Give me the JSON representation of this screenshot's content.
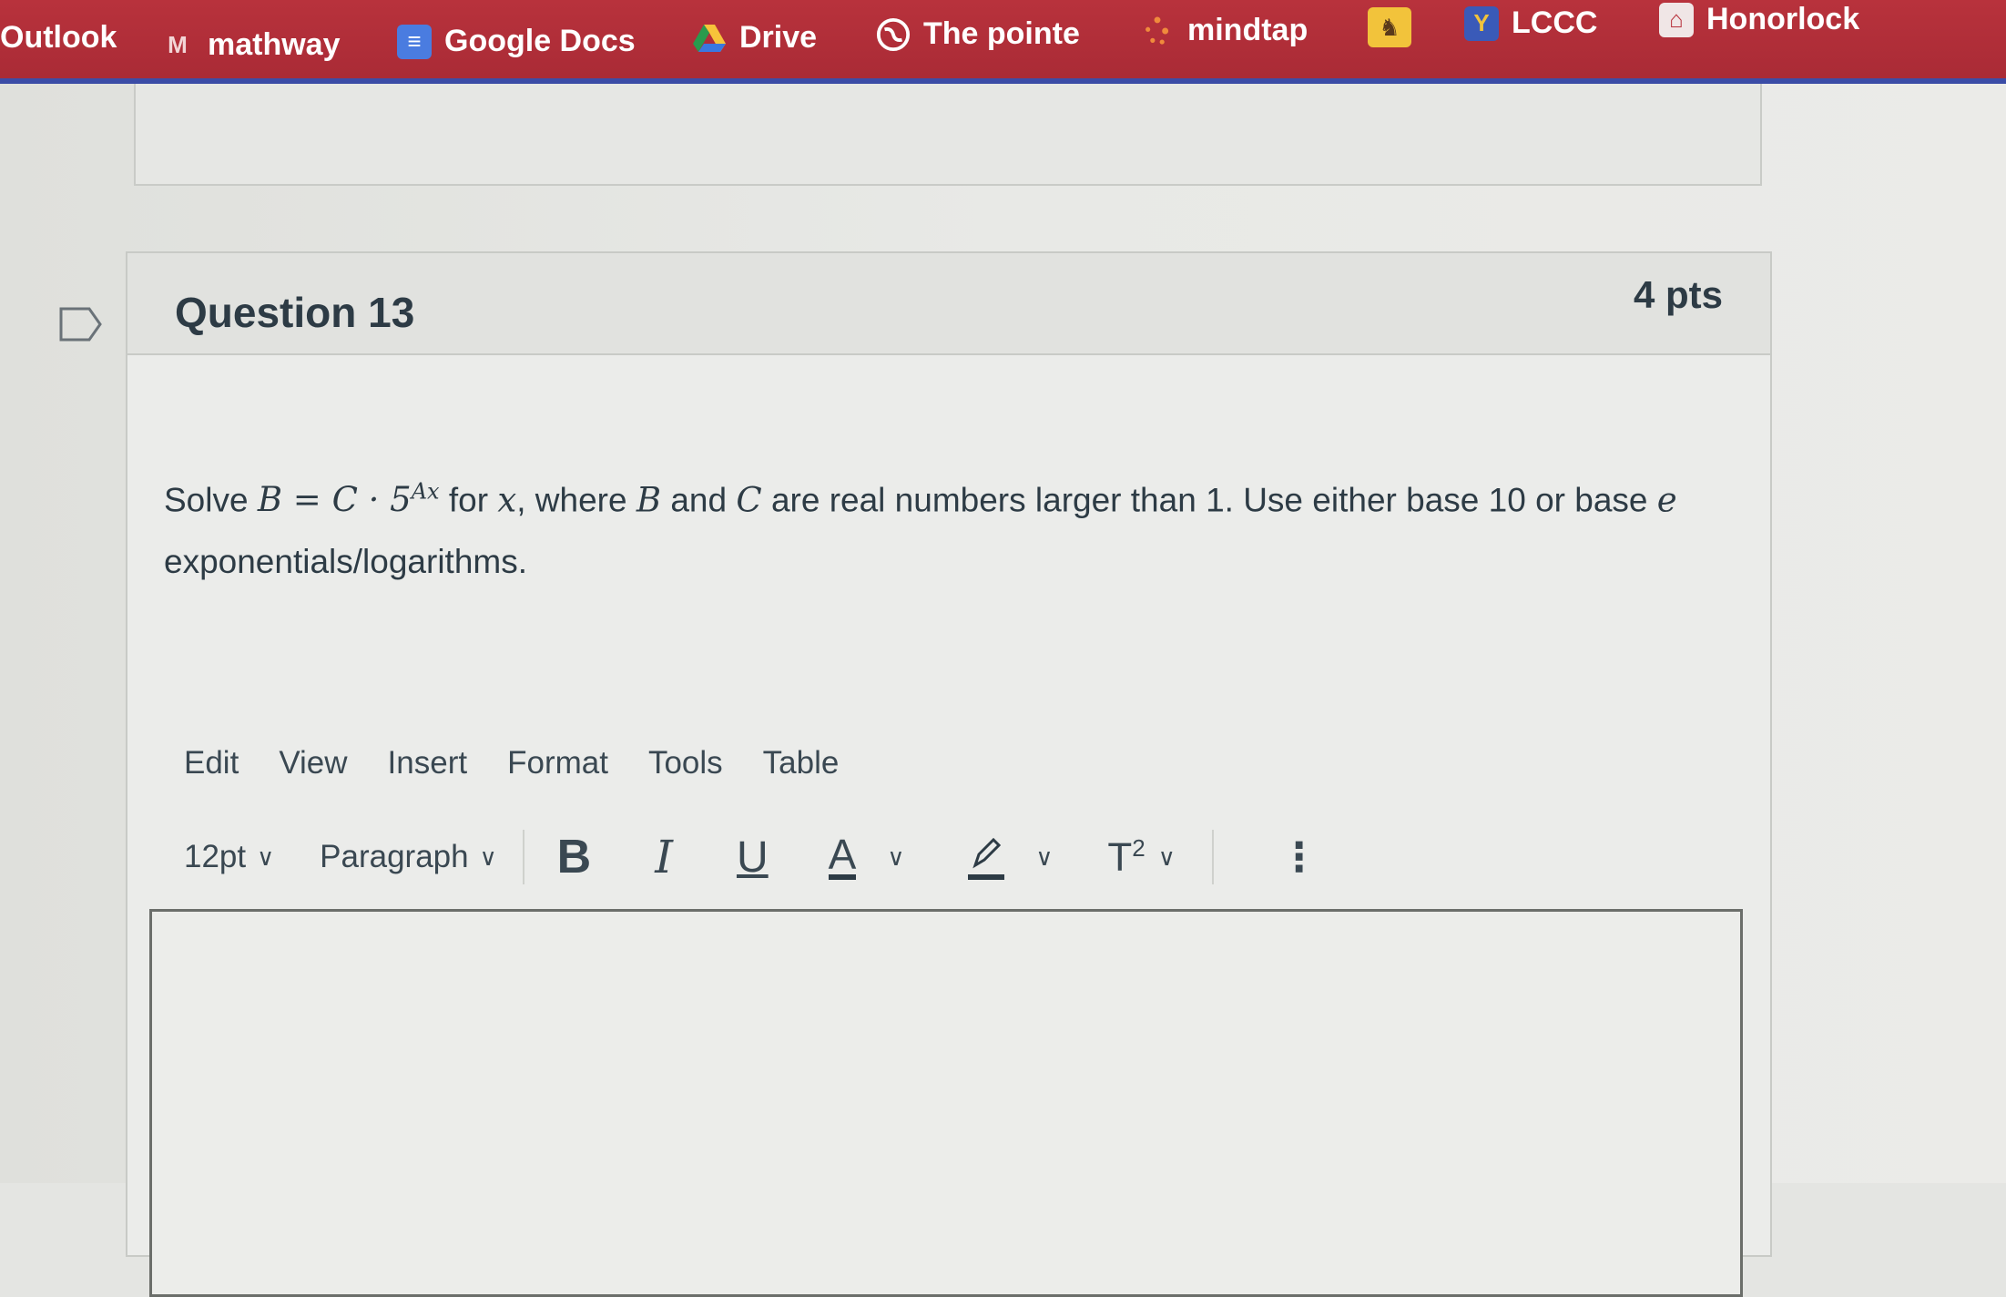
{
  "bookmarks": [
    {
      "label": "Outlook",
      "icon": "outlook-icon"
    },
    {
      "label": "mathway",
      "icon": "mathway-icon"
    },
    {
      "label": "Google Docs",
      "icon": "google-docs-icon"
    },
    {
      "label": "Drive",
      "icon": "drive-icon"
    },
    {
      "label": "The pointe",
      "icon": "globe-icon"
    },
    {
      "label": "mindtap",
      "icon": "mindtap-icon"
    },
    {
      "label": "",
      "icon": "cowboy-icon"
    },
    {
      "label": "LCCC",
      "icon": "lccc-icon"
    },
    {
      "label": "Honorlock",
      "icon": "honorlock-icon"
    }
  ],
  "question": {
    "title": "Question 13",
    "points": "4 pts",
    "text_solve": "Solve",
    "text_for": "for",
    "text_where": ", where",
    "text_and": "and",
    "text_rest": "are real numbers larger than 1.  Use either base 10 or base",
    "text_end": "exponentials/logarithms.",
    "math_B": "B",
    "math_eq": " = ",
    "math_C": "C",
    "math_dot": " · 5",
    "math_exp": "Ax",
    "math_x": "x",
    "math_e": "e"
  },
  "editor": {
    "menu": [
      "Edit",
      "View",
      "Insert",
      "Format",
      "Tools",
      "Table"
    ],
    "font_size": "12pt",
    "block_format": "Paragraph",
    "bold": "B",
    "italic": "I",
    "underline": "U",
    "text_color": "A",
    "superscript_base": "T",
    "superscript_exp": "2",
    "more": "⋮"
  },
  "colors": {
    "bookmark_bar": "#b8323c",
    "accent_bar": "#3c4da8",
    "text": "#2d3b45"
  }
}
